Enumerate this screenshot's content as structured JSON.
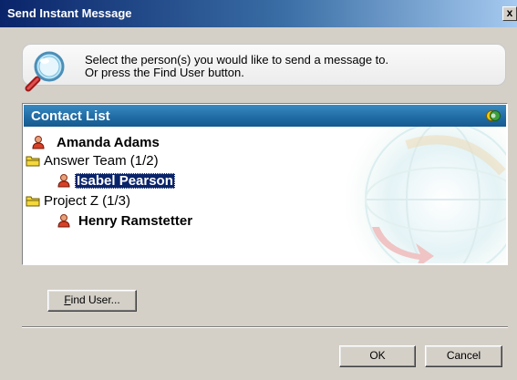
{
  "window": {
    "title": "Send Instant Message",
    "close_label": "x"
  },
  "info": {
    "line1": "Select the person(s) you would like to send a message to.",
    "line2": "Or press the Find User button.",
    "icon": "magnifier-icon"
  },
  "contact_list": {
    "header": "Contact List",
    "items": [
      {
        "label": "Amanda Adams",
        "type": "contact",
        "icon": "person-icon",
        "bold": true,
        "selected": false
      },
      {
        "label": "Answer Team  (1/2)",
        "type": "group",
        "icon": "folder-icon",
        "bold": false,
        "selected": false
      },
      {
        "label": "Isabel Pearson",
        "type": "contact",
        "icon": "person-icon",
        "bold": true,
        "selected": true
      },
      {
        "label": "Project Z  (1/3)",
        "type": "group",
        "icon": "folder-icon",
        "bold": false,
        "selected": false
      },
      {
        "label": "Henry Ramstetter",
        "type": "contact",
        "icon": "person-icon",
        "bold": true,
        "selected": false
      }
    ]
  },
  "buttons": {
    "find_user_first": "F",
    "find_user_rest": "ind User...",
    "ok": "OK",
    "cancel": "Cancel"
  },
  "colors": {
    "title_bar": "#0a246a",
    "header": "#1f6aa2",
    "selection": "#0a246a",
    "dialog": "#d4d0c8"
  }
}
